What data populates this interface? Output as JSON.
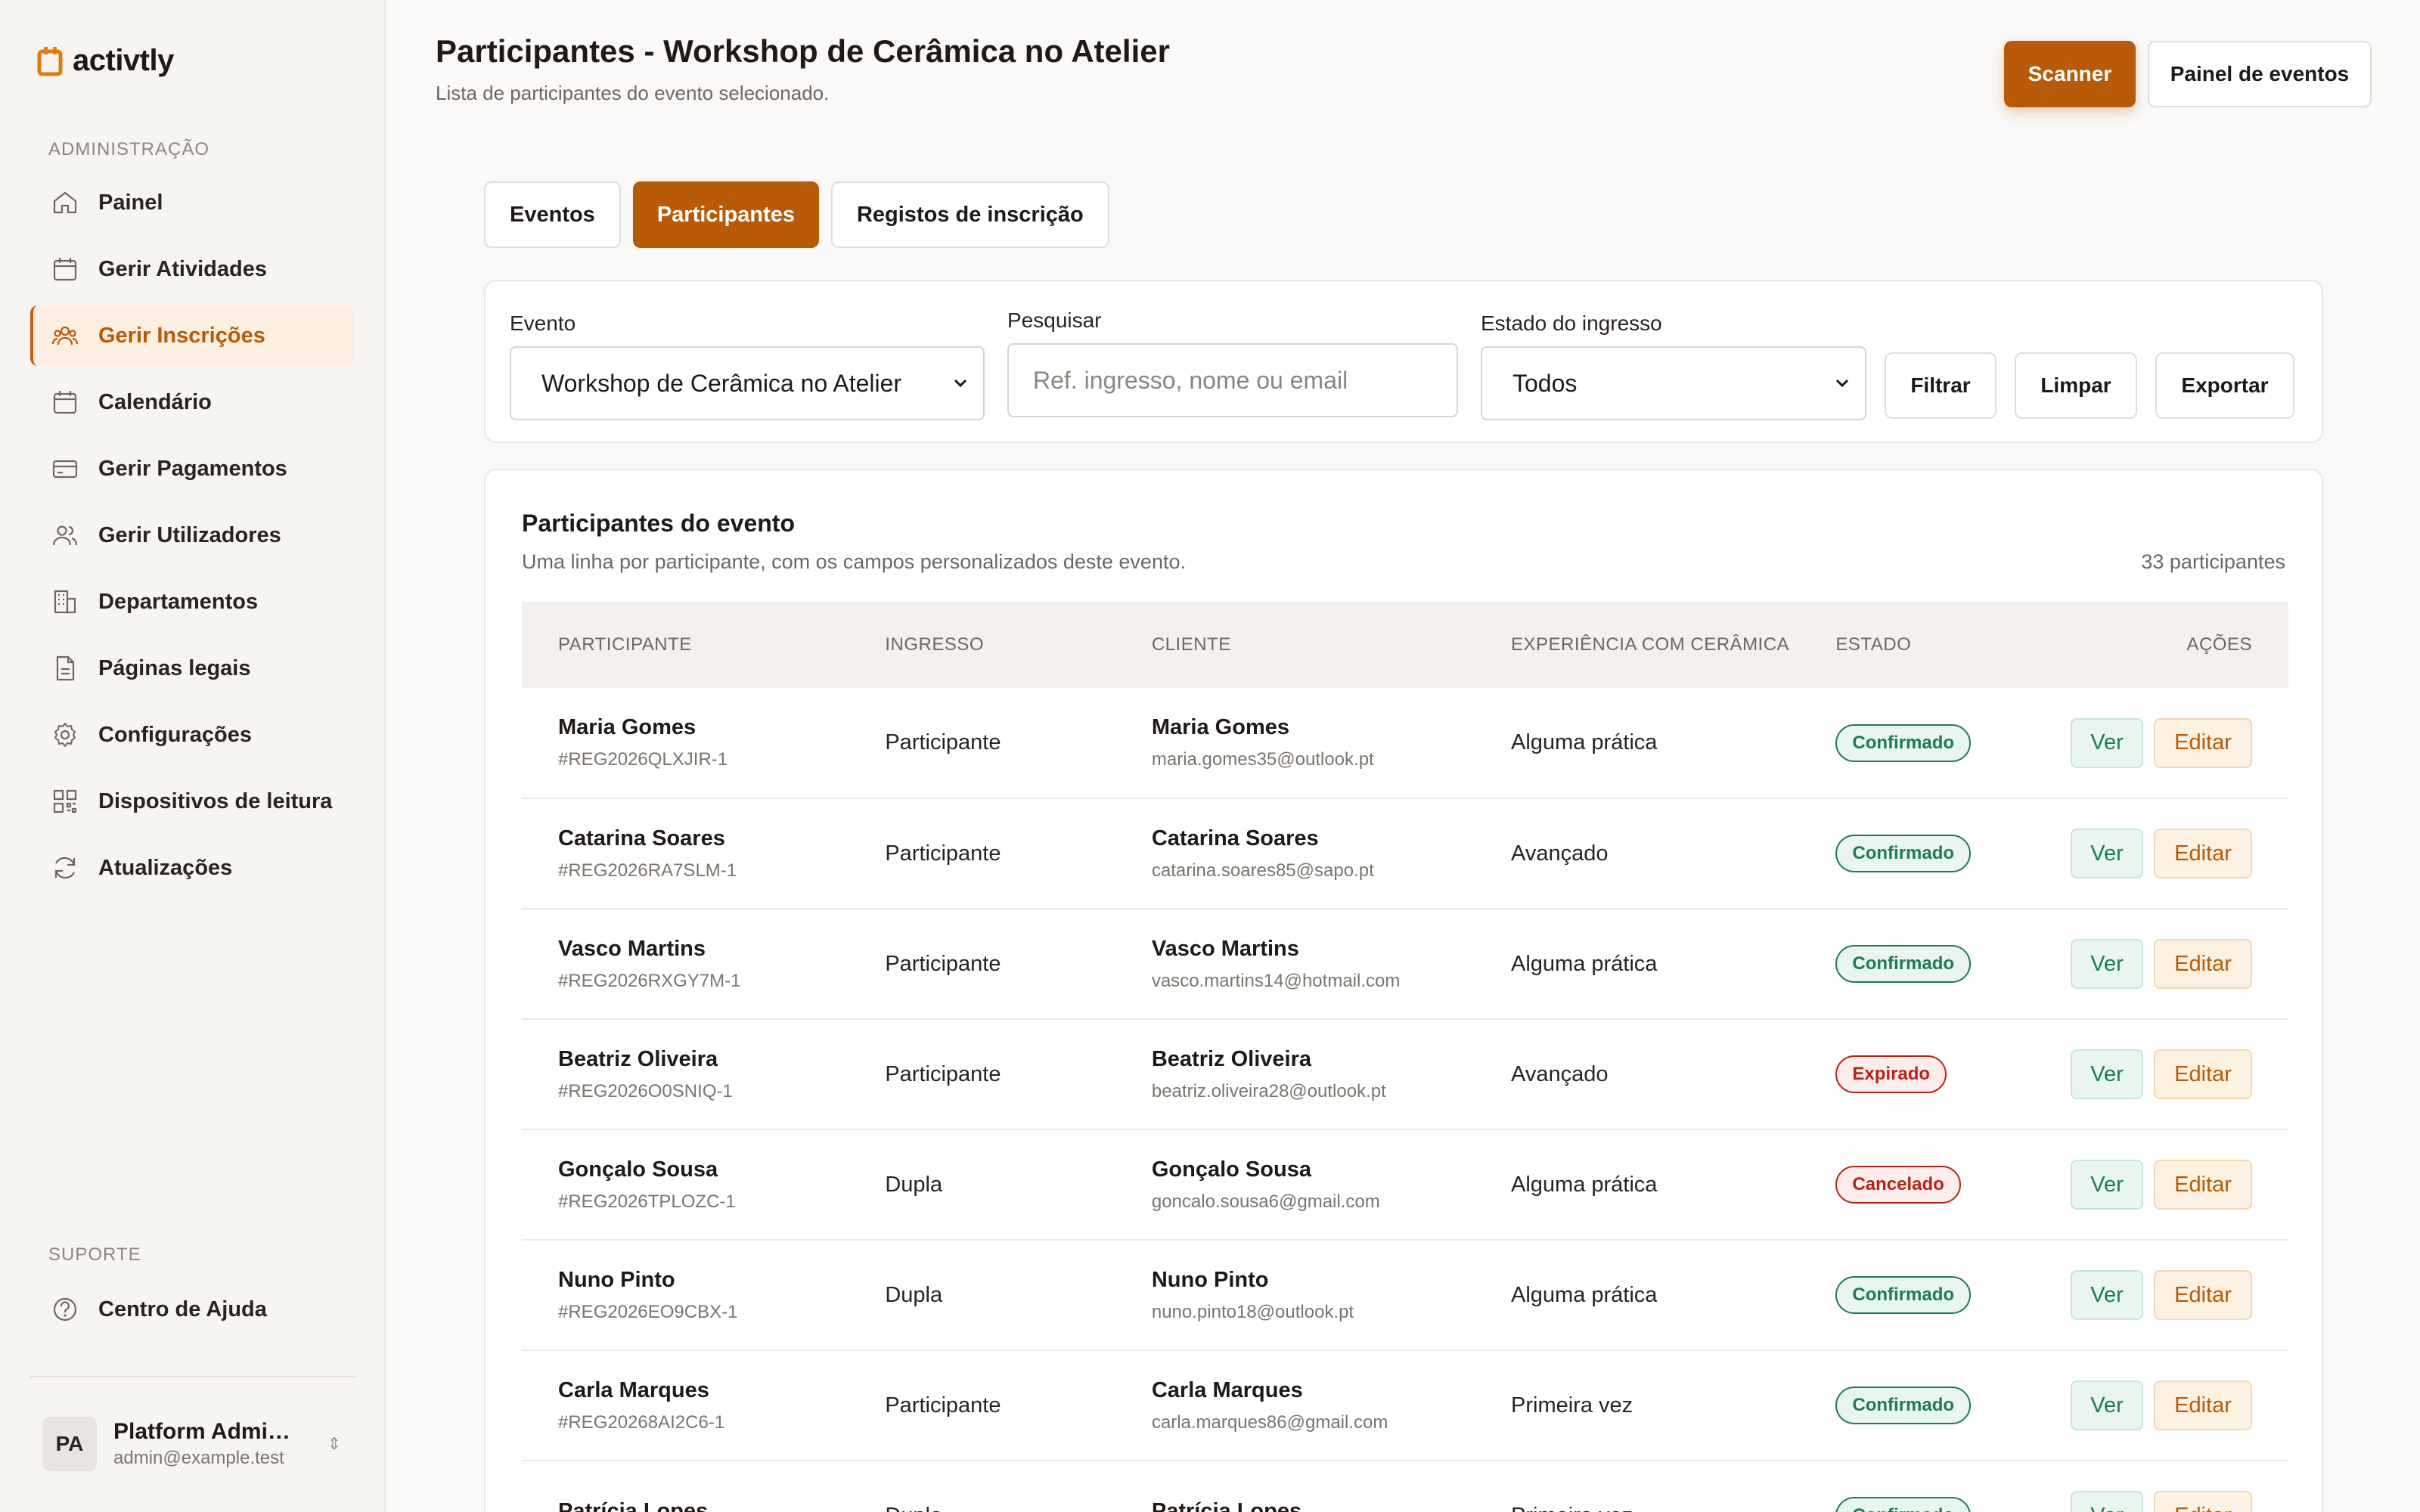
{
  "app": {
    "logo_text": "activtly"
  },
  "sidebar": {
    "admin_label": "ADMINISTRAÇÃO",
    "items": [
      {
        "label": "Painel",
        "icon": "home-icon"
      },
      {
        "label": "Gerir Atividades",
        "icon": "calendar-icon"
      },
      {
        "label": "Gerir Inscrições",
        "icon": "users-group-icon",
        "active": true
      },
      {
        "label": "Calendário",
        "icon": "calendar-icon"
      },
      {
        "label": "Gerir Pagamentos",
        "icon": "credit-card-icon"
      },
      {
        "label": "Gerir Utilizadores",
        "icon": "users-icon"
      },
      {
        "label": "Departamentos",
        "icon": "building-icon"
      },
      {
        "label": "Páginas legais",
        "icon": "document-icon"
      },
      {
        "label": "Configurações",
        "icon": "gear-icon"
      },
      {
        "label": "Dispositivos de leitura",
        "icon": "qr-code-icon"
      },
      {
        "label": "Atualizações",
        "icon": "refresh-icon"
      }
    ],
    "support_label": "SUPORTE",
    "support_items": [
      {
        "label": "Centro de Ajuda",
        "icon": "help-icon"
      }
    ],
    "user": {
      "initials": "PA",
      "name": "Platform Admini...",
      "email": "admin@example.test"
    }
  },
  "header": {
    "title": "Participantes - Workshop de Cerâmica no Atelier",
    "subtitle": "Lista de participantes do evento selecionado.",
    "scanner_label": "Scanner",
    "panel_label": "Painel de eventos"
  },
  "tabs": [
    {
      "label": "Eventos",
      "active": false
    },
    {
      "label": "Participantes",
      "active": true
    },
    {
      "label": "Registos de inscrição",
      "active": false
    }
  ],
  "filters": {
    "event_label": "Evento",
    "event_value": "Workshop de Cerâmica no Atelier",
    "search_label": "Pesquisar",
    "search_placeholder": "Ref. ingresso, nome ou email",
    "status_label": "Estado do ingresso",
    "status_value": "Todos",
    "filter_button": "Filtrar",
    "clear_button": "Limpar",
    "export_button": "Exportar"
  },
  "participants_card": {
    "title": "Participantes do evento",
    "subtitle": "Uma linha por participante, com os campos personalizados deste evento.",
    "count": "33 participantes",
    "columns": [
      "PARTICIPANTE",
      "INGRESSO",
      "CLIENTE",
      "EXPERIÊNCIA COM CERÂMICA",
      "ESTADO",
      "AÇÕES"
    ],
    "view_label": "Ver",
    "edit_label": "Editar",
    "rows": [
      {
        "name": "Maria Gomes",
        "ref": "#REG2026QLXJIR-1",
        "ticket": "Participante",
        "client_name": "Maria Gomes",
        "client_email": "maria.gomes35@outlook.pt",
        "experience": "Alguma prática",
        "status": "Confirmado",
        "status_kind": "ok"
      },
      {
        "name": "Catarina Soares",
        "ref": "#REG2026RA7SLM-1",
        "ticket": "Participante",
        "client_name": "Catarina Soares",
        "client_email": "catarina.soares85@sapo.pt",
        "experience": "Avançado",
        "status": "Confirmado",
        "status_kind": "ok"
      },
      {
        "name": "Vasco Martins",
        "ref": "#REG2026RXGY7M-1",
        "ticket": "Participante",
        "client_name": "Vasco Martins",
        "client_email": "vasco.martins14@hotmail.com",
        "experience": "Alguma prática",
        "status": "Confirmado",
        "status_kind": "ok"
      },
      {
        "name": "Beatriz Oliveira",
        "ref": "#REG2026O0SNIQ-1",
        "ticket": "Participante",
        "client_name": "Beatriz Oliveira",
        "client_email": "beatriz.oliveira28@outlook.pt",
        "experience": "Avançado",
        "status": "Expirado",
        "status_kind": "bad"
      },
      {
        "name": "Gonçalo Sousa",
        "ref": "#REG2026TPLOZC-1",
        "ticket": "Dupla",
        "client_name": "Gonçalo Sousa",
        "client_email": "goncalo.sousa6@gmail.com",
        "experience": "Alguma prática",
        "status": "Cancelado",
        "status_kind": "bad"
      },
      {
        "name": "Nuno Pinto",
        "ref": "#REG2026EO9CBX-1",
        "ticket": "Dupla",
        "client_name": "Nuno Pinto",
        "client_email": "nuno.pinto18@outlook.pt",
        "experience": "Alguma prática",
        "status": "Confirmado",
        "status_kind": "ok"
      },
      {
        "name": "Carla Marques",
        "ref": "#REG20268AI2C6-1",
        "ticket": "Participante",
        "client_name": "Carla Marques",
        "client_email": "carla.marques86@gmail.com",
        "experience": "Primeira vez",
        "status": "Confirmado",
        "status_kind": "ok"
      },
      {
        "name": "Patrícia Lopes",
        "ref": "",
        "ticket": "Dupla",
        "client_name": "Patrícia Lopes",
        "client_email": "",
        "experience": "Primeira vez",
        "status": "Confirmado",
        "status_kind": "ok"
      }
    ]
  },
  "colors": {
    "accent": "#b85a07",
    "confirmed": "#1d7a52",
    "negative": "#b42318"
  }
}
